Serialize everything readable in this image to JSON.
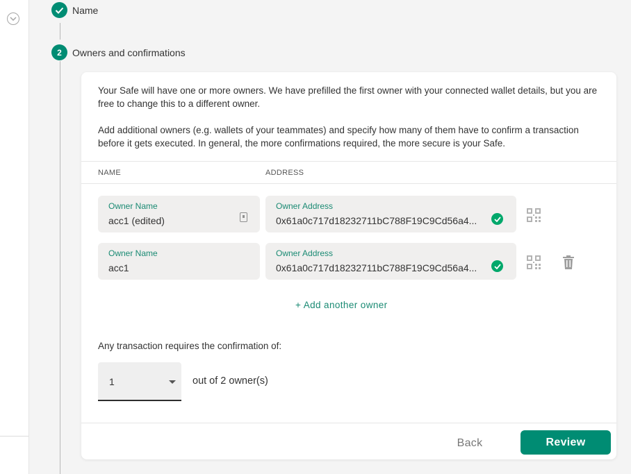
{
  "steps": [
    {
      "label": "Name",
      "status": "completed"
    },
    {
      "number": "2",
      "label": "Owners and confirmations",
      "status": "active"
    }
  ],
  "description": {
    "paragraph1": "Your Safe will have one or more owners. We have prefilled the first owner with your connected wallet details, but you are free to change this to a different owner.",
    "paragraph2": "Add additional owners (e.g. wallets of your teammates) and specify how many of them have to confirm a transaction before it gets executed. In general, the more confirmations required, the more secure is your Safe."
  },
  "table": {
    "col_name": "NAME",
    "col_address": "ADDRESS"
  },
  "owners": [
    {
      "name_label": "Owner Name",
      "name_value": "acc1 (edited)",
      "address_label": "Owner Address",
      "address_value": "0x61a0c717d18232711bC788F19C9Cd56a4..."
    },
    {
      "name_label": "Owner Name",
      "name_value": "acc1",
      "address_label": "Owner Address",
      "address_value": "0x61a0c717d18232711bC788F19C9Cd56a4..."
    }
  ],
  "add_owner_label": "+ Add another owner",
  "threshold": {
    "prompt": "Any transaction requires the confirmation of:",
    "selected": "1",
    "suffix": "out of 2 owner(s)"
  },
  "buttons": {
    "back": "Back",
    "review": "Review"
  },
  "colors": {
    "accent": "#008c73",
    "label_green": "#1a8a73",
    "valid_check": "#00a86b"
  },
  "icons": [
    "chevron-down-circle-icon",
    "check-icon",
    "address-book-icon",
    "valid-check-icon",
    "qr-code-icon",
    "trash-icon"
  ]
}
